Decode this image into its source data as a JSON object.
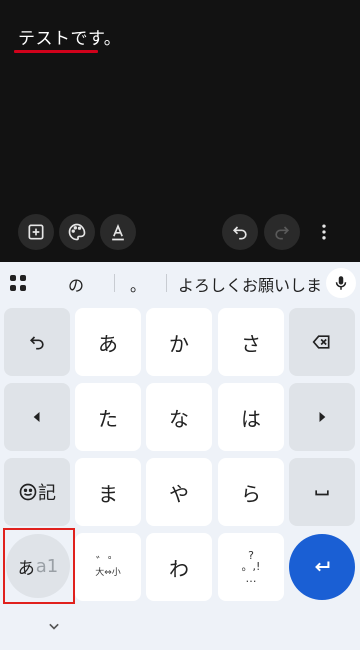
{
  "editor": {
    "text": "テストです。"
  },
  "toolbar": {
    "icons": [
      "add-box-icon",
      "palette-icon",
      "text-format-icon",
      "undo-icon",
      "redo-icon",
      "more-vert-icon"
    ]
  },
  "suggestions": {
    "items": [
      "の",
      "。",
      "よろしくお願いします"
    ]
  },
  "keys": {
    "undo": "",
    "a": "あ",
    "ka": "か",
    "sa": "さ",
    "ta": "た",
    "na": "な",
    "ha": "は",
    "emoji_label": "記",
    "ma": "ま",
    "ya": "や",
    "ra": "ら",
    "mode_kana": "あ",
    "mode_alpha": "a1",
    "dakuten_top": "゛゜",
    "dakuten_bottom": "大⇔小",
    "wa": "わ",
    "punct_top": "?",
    "punct_mid": "。,!",
    "punct_bottom": "…"
  },
  "colors": {
    "accent": "#1a5fd4",
    "underline": "#d0021b",
    "highlight": "#e0211d"
  }
}
